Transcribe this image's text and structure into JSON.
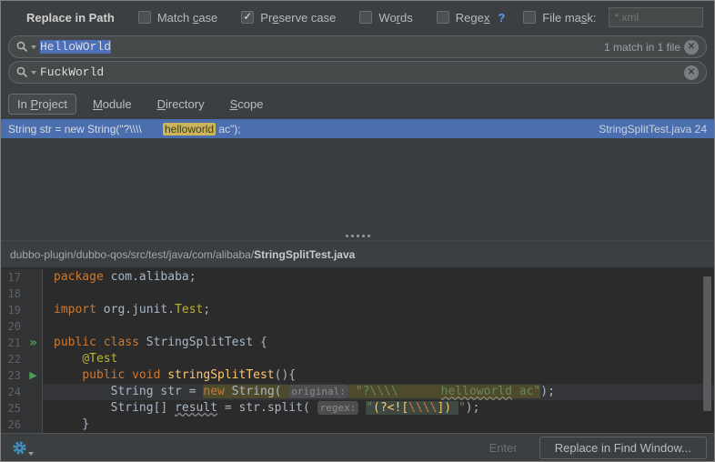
{
  "toolbar": {
    "title": "Replace in Path",
    "checkboxes": [
      {
        "pre": "Match ",
        "mn": "c",
        "post": "ase",
        "checked": false
      },
      {
        "pre": "Pr",
        "mn": "e",
        "post": "serve case",
        "checked": true
      },
      {
        "pre": "Wo",
        "mn": "r",
        "post": "ds",
        "checked": false
      },
      {
        "pre": "Rege",
        "mn": "x",
        "post": "",
        "checked": false,
        "help": "?"
      },
      {
        "pre": "File ma",
        "mn": "s",
        "post": "k:",
        "checked": false
      }
    ],
    "file_mask_value": "*.xml"
  },
  "search": {
    "value": "HelloWOrld",
    "badge": "1 match in 1 file"
  },
  "replace": {
    "value": "FuckWorld"
  },
  "scope_tabs": [
    {
      "pre": "In ",
      "mn": "P",
      "post": "roject",
      "selected": true
    },
    {
      "pre": "",
      "mn": "M",
      "post": "odule",
      "selected": false
    },
    {
      "pre": "",
      "mn": "D",
      "post": "irectory",
      "selected": false
    },
    {
      "pre": "",
      "mn": "S",
      "post": "cope",
      "selected": false
    }
  ],
  "result_row": {
    "before": "String str = new String(\"?\\\\\\\\       ",
    "match": "helloworld",
    "after": " ac\");",
    "location": "StringSplitTest.java 24"
  },
  "breadcrumb": {
    "path": "dubbo-plugin/dubbo-qos/src/test/java/com/alibaba/",
    "file": "StringSplitTest.java"
  },
  "editor": {
    "lines": [
      {
        "num": "17",
        "tokens": [
          {
            "t": "package ",
            "c": "kw"
          },
          {
            "t": "com.alibaba;",
            "c": "pl"
          }
        ]
      },
      {
        "num": "18",
        "tokens": []
      },
      {
        "num": "19",
        "tokens": [
          {
            "t": "import ",
            "c": "kw"
          },
          {
            "t": "org.junit.",
            "c": "pl"
          },
          {
            "t": "Test",
            "c": "ann"
          },
          {
            "t": ";",
            "c": "pl"
          }
        ]
      },
      {
        "num": "20",
        "tokens": []
      },
      {
        "num": "21",
        "gutter": "run-class",
        "tokens": [
          {
            "t": "public class ",
            "c": "kw"
          },
          {
            "t": "StringSplitTest {",
            "c": "pl"
          }
        ]
      },
      {
        "num": "22",
        "tokens": [
          {
            "t": "    ",
            "c": "pl"
          },
          {
            "t": "@Test",
            "c": "ann"
          }
        ]
      },
      {
        "num": "23",
        "gutter": "run-method",
        "tokens": [
          {
            "t": "    ",
            "c": "pl"
          },
          {
            "t": "public void ",
            "c": "kw"
          },
          {
            "t": "stringSplitTest",
            "c": "mth"
          },
          {
            "t": "(){",
            "c": "pl"
          }
        ]
      },
      {
        "num": "24",
        "current": true,
        "tokens": [
          {
            "t": "        String str = ",
            "c": "pl"
          },
          {
            "t": "new",
            "c": "kw",
            "hl": true
          },
          {
            "t": " String( ",
            "c": "pl",
            "hl": true
          },
          {
            "t": "original:",
            "c": "inlay",
            "hl": true
          },
          {
            "t": " ",
            "c": "pl",
            "hl": true
          },
          {
            "t": "\"?\\\\\\\\      ",
            "c": "str",
            "hl": true
          },
          {
            "t": "helloworld",
            "c": "str",
            "hl": true,
            "wavy": true
          },
          {
            "t": " ac\"",
            "c": "str",
            "hl": true
          },
          {
            "t": ");",
            "c": "pl"
          }
        ]
      },
      {
        "num": "25",
        "tokens": [
          {
            "t": "        String[] ",
            "c": "pl"
          },
          {
            "t": "result",
            "c": "pl",
            "wavy": true
          },
          {
            "t": " = str.split( ",
            "c": "pl"
          },
          {
            "t": "regex:",
            "c": "inlay"
          },
          {
            "t": " ",
            "c": "pl"
          },
          {
            "t": "\"",
            "c": "rxs"
          },
          {
            "t": "(?<![",
            "c": "rxp"
          },
          {
            "t": "\\\\\\\\",
            "c": "rxe"
          },
          {
            "t": "])",
            "c": "rxp"
          },
          {
            "t": " ",
            "c": "rxs"
          },
          {
            "t": "\"",
            "c": "str"
          },
          {
            "t": ");",
            "c": "pl"
          }
        ]
      },
      {
        "num": "26",
        "tokens": [
          {
            "t": "    }",
            "c": "pl"
          }
        ]
      }
    ]
  },
  "footer": {
    "hint": "Enter",
    "button": "Replace in Find Window..."
  },
  "colors": {
    "accent_blue": "#3592C4",
    "selection_blue": "#4B6EAF",
    "match_highlight": "#CCB659",
    "keyword": "#CC7832",
    "string": "#6A8759",
    "annotation": "#BBB529",
    "method": "#FFC66D"
  }
}
